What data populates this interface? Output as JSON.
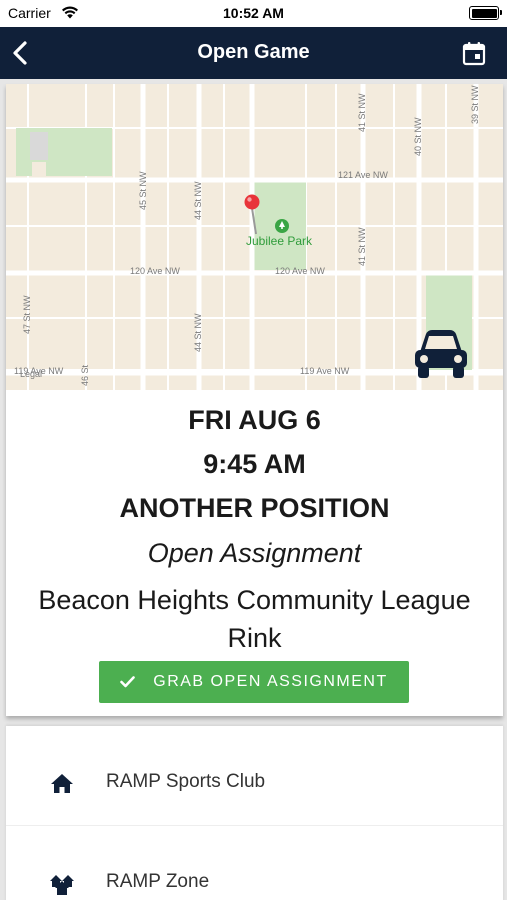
{
  "status_bar": {
    "carrier": "Carrier",
    "time": "10:52 AM"
  },
  "nav": {
    "title": "Open Game",
    "back_icon": "chevron-left-icon",
    "calendar_icon": "calendar-icon"
  },
  "map": {
    "streets": {
      "ave_121": "121 Ave NW",
      "ave_120_left": "120 Ave NW",
      "ave_120_right": "120 Ave NW",
      "ave_119_left": "119 Ave NW",
      "ave_119_right": "119 Ave NW",
      "st_45": "45 St NW",
      "st_44_top": "44 St NW",
      "st_44_bottom": "44 St NW",
      "st_41_top": "41 St NW",
      "st_41_bottom": "41 St NW",
      "st_40": "40 St NW",
      "st_39": "39 St NW",
      "st_47": "47 St NW",
      "st_46": "46 St",
      "legal": "Legal"
    },
    "park_name": "Jubilee Park",
    "pin_color": "#e8343a",
    "directions_icon": "car-icon"
  },
  "game": {
    "date": "FRI AUG 6",
    "time": "9:45 AM",
    "position": "ANOTHER POSITION",
    "assignment_type": "Open Assignment",
    "venue": "Beacon Heights Community League Rink"
  },
  "actions": {
    "grab_label": "GRAB OPEN ASSIGNMENT",
    "grab_color": "#4caf50"
  },
  "details": [
    {
      "icon": "home-icon",
      "label": "RAMP Sports Club"
    },
    {
      "icon": "zone-icon",
      "label": "RAMP Zone"
    }
  ],
  "colors": {
    "nav_bg": "#102039",
    "accent": "#102039"
  }
}
